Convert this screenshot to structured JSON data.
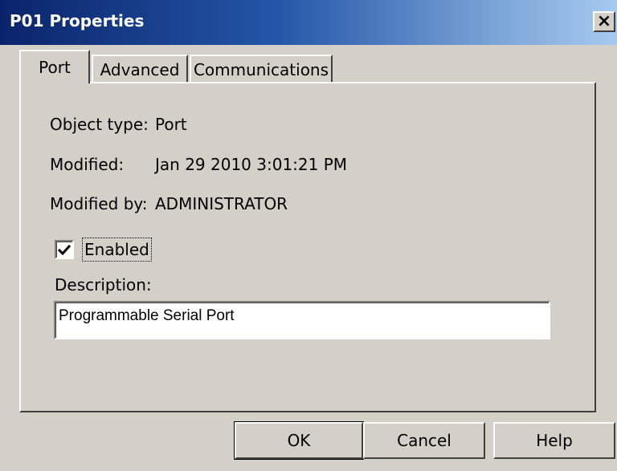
{
  "window": {
    "title": "P01 Properties",
    "close_glyph": "×"
  },
  "tabs": [
    {
      "label": "Port",
      "active": true
    },
    {
      "label": "Advanced",
      "active": false
    },
    {
      "label": "Communications",
      "active": false
    }
  ],
  "port": {
    "object_type_label": "Object type:",
    "object_type_value": "Port",
    "modified_label": "Modified:",
    "modified_value": "Jan 29 2010 3:01:21 PM",
    "modified_by_label": "Modified by:",
    "modified_by_value": "ADMINISTRATOR",
    "enabled_label": "Enabled",
    "enabled_checked": true,
    "description_label": "Description:",
    "description_value": "Programmable Serial Port"
  },
  "buttons": {
    "ok": "OK",
    "cancel": "Cancel",
    "help": "Help"
  },
  "icons": {
    "close": "close-icon",
    "check": "checkmark-icon"
  }
}
